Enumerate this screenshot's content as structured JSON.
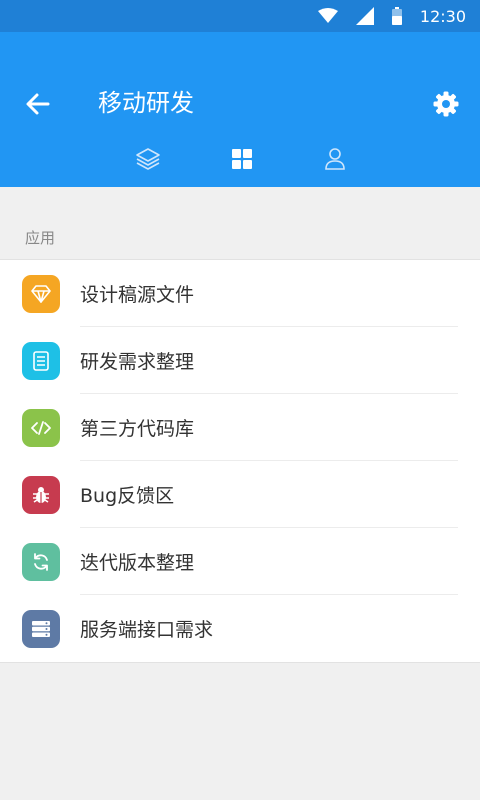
{
  "status": {
    "time": "12:30"
  },
  "header": {
    "title": "移动研发"
  },
  "tabs": [
    {
      "icon": "layers-icon"
    },
    {
      "icon": "grid-icon",
      "active": true
    },
    {
      "icon": "person-icon"
    }
  ],
  "section": {
    "title": "应用"
  },
  "items": [
    {
      "label": "设计稿源文件",
      "icon": "diamond-icon",
      "color": "#f5a623"
    },
    {
      "label": "研发需求整理",
      "icon": "document-icon",
      "color": "#1ec0e6"
    },
    {
      "label": "第三方代码库",
      "icon": "code-icon",
      "color": "#8bc34a"
    },
    {
      "label": "Bug反馈区",
      "icon": "bug-icon",
      "color": "#c73b4f"
    },
    {
      "label": "迭代版本整理",
      "icon": "refresh-icon",
      "color": "#5fbf9f"
    },
    {
      "label": "服务端接口需求",
      "icon": "server-icon",
      "color": "#5e7aa5"
    }
  ]
}
